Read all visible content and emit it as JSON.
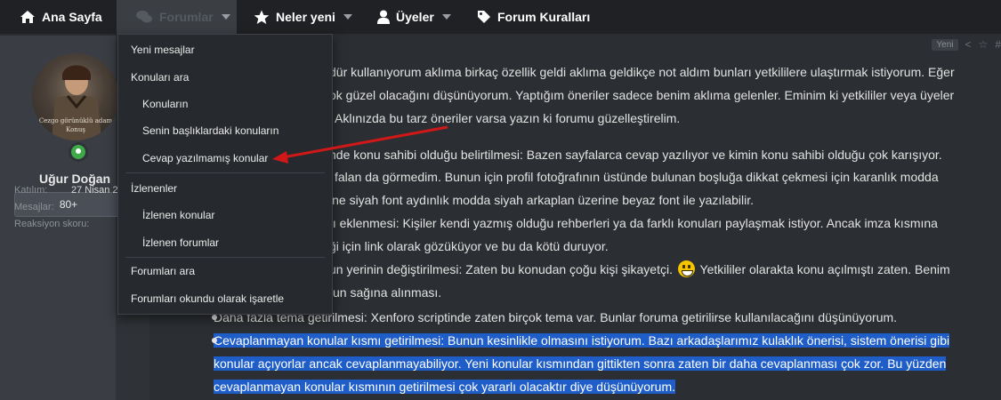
{
  "nav": {
    "home_label": "Ana Sayfa",
    "forums_label": "Forumlar",
    "whats_new_label": "Neler yeni",
    "members_label": "Üyeler",
    "rules_label": "Forum Kuralları"
  },
  "forums_menu": {
    "items": [
      {
        "label": "Yeni mesajlar"
      },
      {
        "label": "Konuları ara"
      },
      {
        "label": "Konuların"
      },
      {
        "label": "Senin başlıklardaki konuların"
      },
      {
        "label": "Cevap yazılmamış konular"
      },
      {
        "label": "İzlenenler"
      },
      {
        "label": "İzlenen konular"
      },
      {
        "label": "İzlenen forumlar"
      },
      {
        "label": "Forumları ara"
      },
      {
        "label": "Forumları okundu olarak işaretle"
      }
    ]
  },
  "user": {
    "avatar_caption_line1": "Cezgo görünüklü adam",
    "avatar_caption_line2": "Konuş",
    "name": "Uğur Doğan",
    "rank": "80+",
    "joined_label": "Katılım:",
    "joined_value": "27 Nisan 2",
    "messages_label": "Mesajlar:",
    "reaction_label": "Reaksiyon skoru:"
  },
  "post": {
    "badge": "Yeni",
    "intro_lines": [
      "dür kullanıyorum aklıma birkaç özellik geldi aklıma geldikçe not aldım bunları yetkililere ulaştırmak istiyorum. Eğer",
      "ok güzel olacağını düşünüyorum. Yaptığım öneriler sadece benim aklıma gelenler. Eminim ki yetkililer veya üyeler",
      "Aklınızda bu tarz öneriler varsa yazın ki forumu güzelleştirelim."
    ],
    "item1_lines": [
      "nde konu sahibi olduğu belirtilmesi: Bazen sayfalarca cevap yazılıyor ve kimin konu sahibi olduğu çok karışıyor.",
      "falan da görmedim. Bunun için profil fotoğrafının üstünde bulunan boşluğa dikkat çekmesi için karanlık modda",
      "ine siyah font aydınlık modda siyah arkaplan üzerine beyaz font ile yazılabilir."
    ],
    "item2_lines": [
      "tı eklenmesi: Kişiler kendi yazmış olduğu rehberleri ya da farklı konuları paylaşmak istiyor. Ancak imza kısmına",
      "ği için link olarak gözüküyor ve bu da kötü duruyor."
    ],
    "item3_line1_a": "un yerinin değiştirilmesi: Zaten bu konudan çoğu kişi şikayetçi.",
    "item3_line1_b": "Yetkililer olaraktа konu açılmıştı zaten. Benim",
    "item3_line2": "un sağına alınması.",
    "bullet4": "Daha fazla tema getirilmesi: Xenforo scriptinde zaten birçok tema var. Bunlar foruma getirilirse kullanılacağını düşünüyorum.",
    "bullet5_lines": [
      "Cevaplanmayan konular kısmı getirilmesi: Bunun kesinlikle olmasını istiyorum. Bazı arkadaşlarımız kulaklık önerisi, sistem önerisi gibi",
      "konular açıyorlar ancak cevaplanmayabiliyor. Yeni konular kısmından gittikten sonra zaten bir daha cevaplanması çok zor. Bu yüzden",
      "cevaplanmayan konular kısmının getirilmesi çok yararlı olacaktır diye düşünüyorum."
    ]
  },
  "colors": {
    "highlight": "#1f5ec8",
    "arrow": "#d01818",
    "online": "#3fa94a"
  }
}
